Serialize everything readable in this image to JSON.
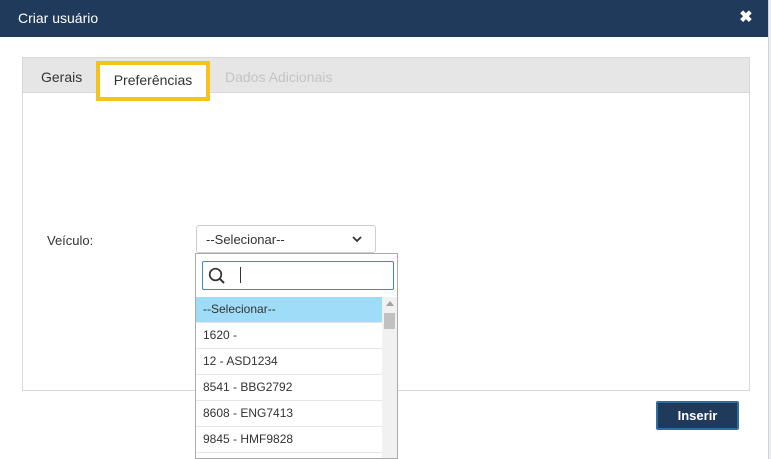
{
  "dialog": {
    "title": "Criar usuário",
    "close_label": "✖"
  },
  "tabs": [
    {
      "label": "Gerais",
      "state": "inactive"
    },
    {
      "label": "Preferências",
      "state": "active"
    },
    {
      "label": "Dados Adicionais",
      "state": "disabled"
    }
  ],
  "form": {
    "vehicle_label": "Veículo:",
    "vehicle_value": "--Selecionar--"
  },
  "dropdown": {
    "search_value": "",
    "options": [
      "--Selecionar--",
      "1620 -",
      "12 - ASD1234",
      "8541 - BBG2792",
      "8608 - ENG7413",
      "9845 - HMF9828"
    ],
    "selected_index": 0
  },
  "footer": {
    "insert_label": "Inserir"
  },
  "colors": {
    "header_bg": "#1f3a5a",
    "highlight": "#f7c21c",
    "selected_option": "#9fdcf7"
  },
  "icons": {
    "close": "close-icon",
    "chevron": "chevron-down-icon",
    "search": "search-icon"
  }
}
